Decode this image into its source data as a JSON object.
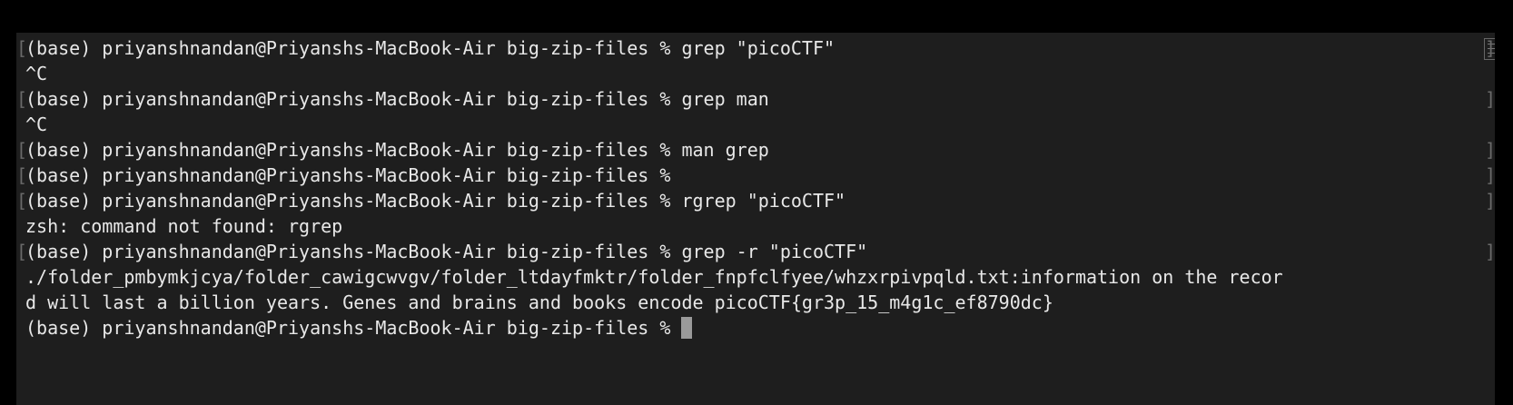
{
  "terminal": {
    "prompt": "(base) priyanshnandan@Priyanshs-MacBook-Air big-zip-files % ",
    "lines": [
      "(base) priyanshnandan@Priyanshs-MacBook-Air big-zip-files % grep \"picoCTF\"",
      "^C",
      "(base) priyanshnandan@Priyanshs-MacBook-Air big-zip-files % grep man",
      "^C",
      "(base) priyanshnandan@Priyanshs-MacBook-Air big-zip-files % man grep",
      "(base) priyanshnandan@Priyanshs-MacBook-Air big-zip-files %",
      "(base) priyanshnandan@Priyanshs-MacBook-Air big-zip-files % rgrep \"picoCTF\"",
      "zsh: command not found: rgrep",
      "(base) priyanshnandan@Priyanshs-MacBook-Air big-zip-files % grep -r \"picoCTF\"",
      "./folder_pmbymkjcya/folder_cawigcwvgv/folder_ltdayfmktr/folder_fnpfclfyee/whzxrpivpqld.txt:information on the recor",
      "d will last a billion years. Genes and brains and books encode picoCTF{gr3p_15_m4g1c_ef8790dc}"
    ]
  }
}
